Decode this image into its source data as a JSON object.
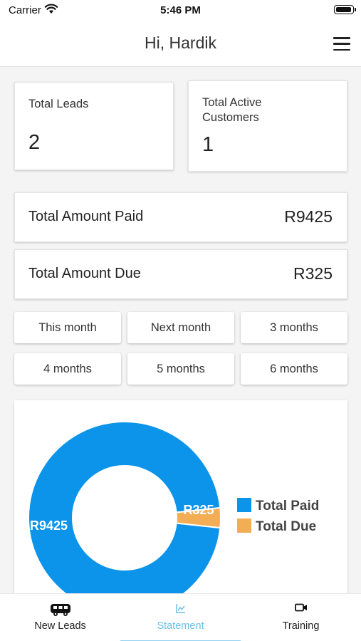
{
  "status_bar": {
    "carrier": "Carrier",
    "time": "5:46 PM"
  },
  "header": {
    "title": "Hi, Hardik"
  },
  "stats": {
    "total_leads_label": "Total Leads",
    "total_leads_value": "2",
    "total_active_label_line1": "Total Active",
    "total_active_label_line2": "Customers",
    "total_active_value": "1"
  },
  "amounts": {
    "paid_label": "Total Amount Paid",
    "paid_value": "R9425",
    "due_label": "Total Amount Due",
    "due_value": "R325"
  },
  "filters": [
    "This month",
    "Next month",
    "3 months",
    "4 months",
    "5 months",
    "6 months"
  ],
  "chart_data": {
    "type": "pie",
    "series": [
      {
        "name": "Total Paid",
        "value": 9425,
        "label": "R9425",
        "color": "#0b94ea"
      },
      {
        "name": "Total Due",
        "value": 325,
        "label": "R325",
        "color": "#f3ad55"
      }
    ],
    "legend_position": "right",
    "donut": true
  },
  "tabs": [
    {
      "label": "New Leads",
      "icon": "bus-icon",
      "active": false
    },
    {
      "label": "Statement",
      "icon": "chart-icon",
      "active": true
    },
    {
      "label": "Training",
      "icon": "video-camera-icon",
      "active": false
    }
  ],
  "colors": {
    "accent": "#0b94ea",
    "due": "#f3ad55",
    "active_tab": "#6bbfe8"
  }
}
